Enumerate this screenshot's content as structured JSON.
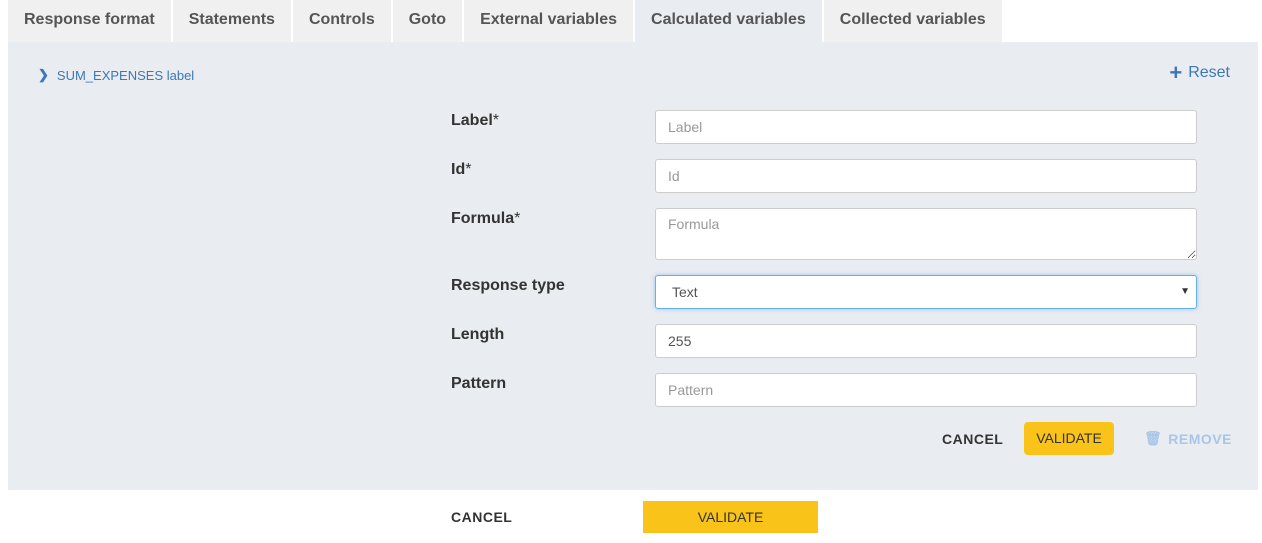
{
  "tabs": [
    {
      "label": "Response format"
    },
    {
      "label": "Statements"
    },
    {
      "label": "Controls"
    },
    {
      "label": "Goto"
    },
    {
      "label": "External variables"
    },
    {
      "label": "Calculated variables",
      "active": true
    },
    {
      "label": "Collected variables"
    }
  ],
  "panel": {
    "expander_label": "SUM_EXPENSES label",
    "reset_label": "Reset",
    "form": {
      "label_field": {
        "label": "Label",
        "required": "*",
        "placeholder": "Label",
        "value": ""
      },
      "id_field": {
        "label": "Id",
        "required": "*",
        "placeholder": "Id",
        "value": ""
      },
      "formula_field": {
        "label": "Formula",
        "required": "*",
        "placeholder": "Formula",
        "value": ""
      },
      "response_type": {
        "label": "Response type",
        "selected": "Text"
      },
      "length_field": {
        "label": "Length",
        "value": "255"
      },
      "pattern_field": {
        "label": "Pattern",
        "placeholder": "Pattern",
        "value": ""
      }
    },
    "actions": {
      "cancel": "CANCEL",
      "validate": "VALIDATE",
      "remove": "REMOVE"
    }
  },
  "footer": {
    "cancel": "CANCEL",
    "validate": "VALIDATE"
  },
  "colors": {
    "accent": "#f9c31a",
    "link": "#3c78b5",
    "panel_bg": "#e9ecf1"
  }
}
